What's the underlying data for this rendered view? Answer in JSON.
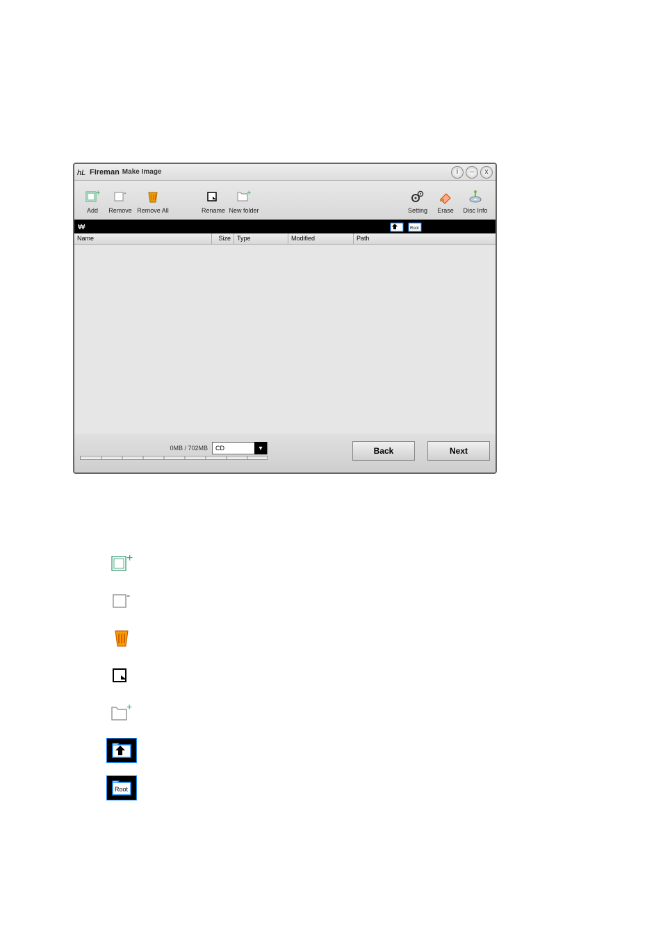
{
  "window": {
    "brand": "Fireman",
    "subtitle": "Make Image"
  },
  "window_controls": {
    "info": "i",
    "minimize": "–",
    "close": "x"
  },
  "toolbar": {
    "add": "Add",
    "remove": "Remove",
    "remove_all": "Remove All",
    "rename": "Rename",
    "new_folder": "New folder",
    "setting": "Setting",
    "erase": "Erase",
    "disc_info": "Disc Info"
  },
  "columns": {
    "name": "Name",
    "size": "Size",
    "type": "Type",
    "modified": "Modified",
    "path": "Path"
  },
  "bottom": {
    "size_label": "0MB / 702MB",
    "media": "CD",
    "back": "Back",
    "next": "Next"
  },
  "legend_icons": {
    "add": "add-icon",
    "remove": "remove-icon",
    "remove_all": "remove-all-icon",
    "rename": "rename-icon",
    "new_folder": "new-folder-icon",
    "up": "folder-up-icon",
    "root": "folder-root-icon",
    "root_label": "Root"
  }
}
